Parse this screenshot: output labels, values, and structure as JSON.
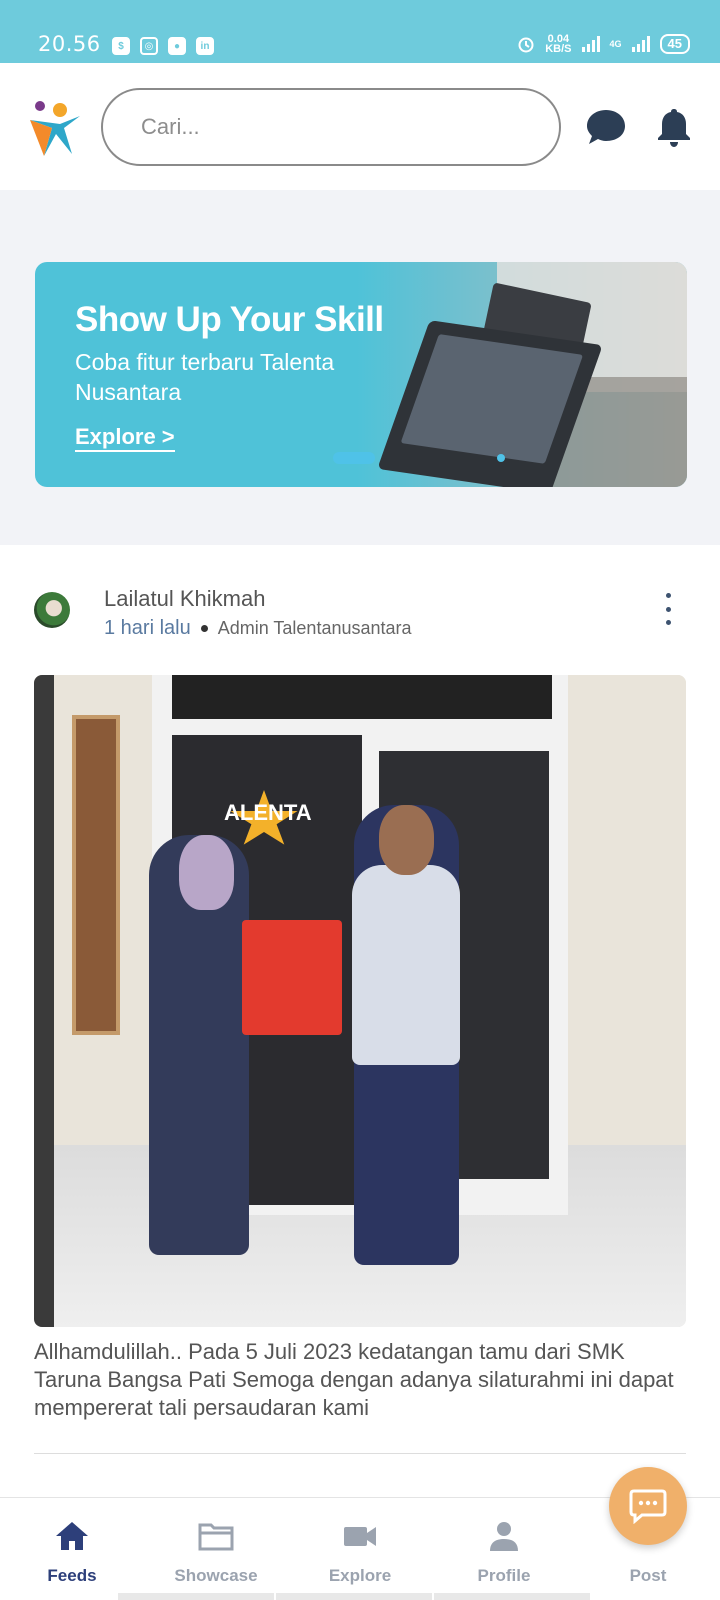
{
  "status_bar": {
    "time": "20.56",
    "data_speed_value": "0.04",
    "data_speed_unit": "KB/S",
    "network": "4G",
    "battery": "45"
  },
  "header": {
    "search_placeholder": "Cari..."
  },
  "banner": {
    "headline": "Show Up Your Skill",
    "subtitle": "Coba fitur terbaru Talenta Nusantara",
    "cta": "Explore >"
  },
  "post": {
    "author": "Lailatul Khikmah",
    "time_ago": "1 hari lalu",
    "role": "Admin Talentanusantara",
    "photo_sign": "ALENTA",
    "caption": "Allhamdulillah.. Pada 5 Juli 2023 kedatangan tamu dari SMK Taruna Bangsa Pati Semoga dengan adanya silaturahmi ini dapat mempererat tali persaudaran kami"
  },
  "bottom_nav": {
    "items": [
      {
        "label": "Feeds",
        "icon": "home-icon",
        "active": true
      },
      {
        "label": "Showcase",
        "icon": "folder-icon",
        "active": false
      },
      {
        "label": "Explore",
        "icon": "video-icon",
        "active": false
      },
      {
        "label": "Profile",
        "icon": "person-icon",
        "active": false
      },
      {
        "label": "Post",
        "icon": "chat-bubble-icon",
        "active": false
      }
    ]
  },
  "colors": {
    "status_bar": "#6ecbdc",
    "banner": "#4fc2d8",
    "nav_active": "#2d3f7a",
    "nav_inactive": "#9ba3af",
    "fab": "#f0b06a",
    "icon_dark": "#2c3e55"
  }
}
